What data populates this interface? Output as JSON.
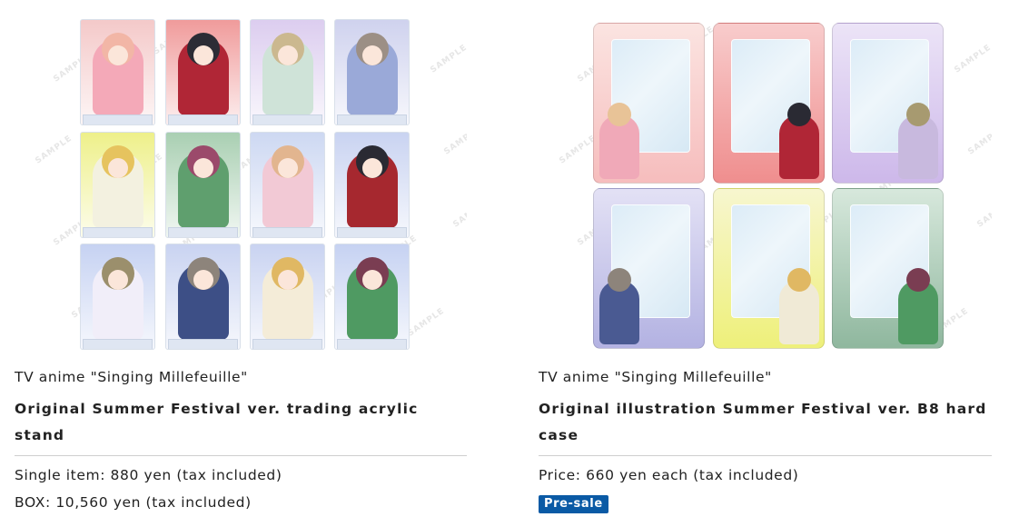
{
  "products": [
    {
      "series": "TV anime \"Singing Millefeuille\"",
      "name": "Original Summer Festival ver. trading acrylic stand",
      "price_lines": [
        "Single item: 880 yen (tax included)",
        "BOX: 10,560 yen (tax included)"
      ],
      "watermark": "SAMPLE",
      "stand_colors": [
        [
          "#f4c9c9",
          "#f2b6a6",
          "#f4a9b8"
        ],
        [
          "#f09b9b",
          "#2c2c35",
          "#b02636"
        ],
        [
          "#dccdef",
          "#cbb88f",
          "#cfe3d8"
        ],
        [
          "#cfd2ee",
          "#9c8f85",
          "#9aa9d8"
        ],
        [
          "#eef08a",
          "#e6c35e",
          "#f3f1e0"
        ],
        [
          "#a9cfb2",
          "#9b4a6b",
          "#5f9f6e"
        ],
        [
          "#cdd8f2",
          "#e2b58f",
          "#f2c9d5"
        ],
        [
          "#c9d3f1",
          "#2a2a33",
          "#a6282f"
        ],
        [
          "#c6d2f2",
          "#9b8f6c",
          "#f1eef9"
        ],
        [
          "#c9d3f1",
          "#8d847b",
          "#3d4f86"
        ],
        [
          "#c9d3f1",
          "#e0b863",
          "#f4ecd8"
        ],
        [
          "#c6d2f2",
          "#7a3d52",
          "#4f9a62"
        ]
      ]
    },
    {
      "series": "TV anime \"Singing Millefeuille\"",
      "name": "Original illustration Summer Festival ver. B8 hard case",
      "price_lines": [
        "Price: 660 yen each (tax included)"
      ],
      "badge": "Pre-sale",
      "watermark": "SAMPLE",
      "case_colors": [
        [
          "#f6bdbd",
          "#fbe4e1",
          "#f0a9b8",
          "#e8c397"
        ],
        [
          "#ef8e8e",
          "#f8cccc",
          "#b02636",
          "#2a2a33"
        ],
        [
          "#cdb8ea",
          "#ece4f7",
          "#c8b9de",
          "#a79a70"
        ],
        [
          "#b3b2e2",
          "#e3e1f5",
          "#4a5a92",
          "#8d847b"
        ],
        [
          "#eef07a",
          "#f7f6cf",
          "#f0ead6",
          "#e0b863"
        ],
        [
          "#8fb79e",
          "#d7e8dc",
          "#4f9a62",
          "#7a3d52"
        ]
      ]
    }
  ]
}
